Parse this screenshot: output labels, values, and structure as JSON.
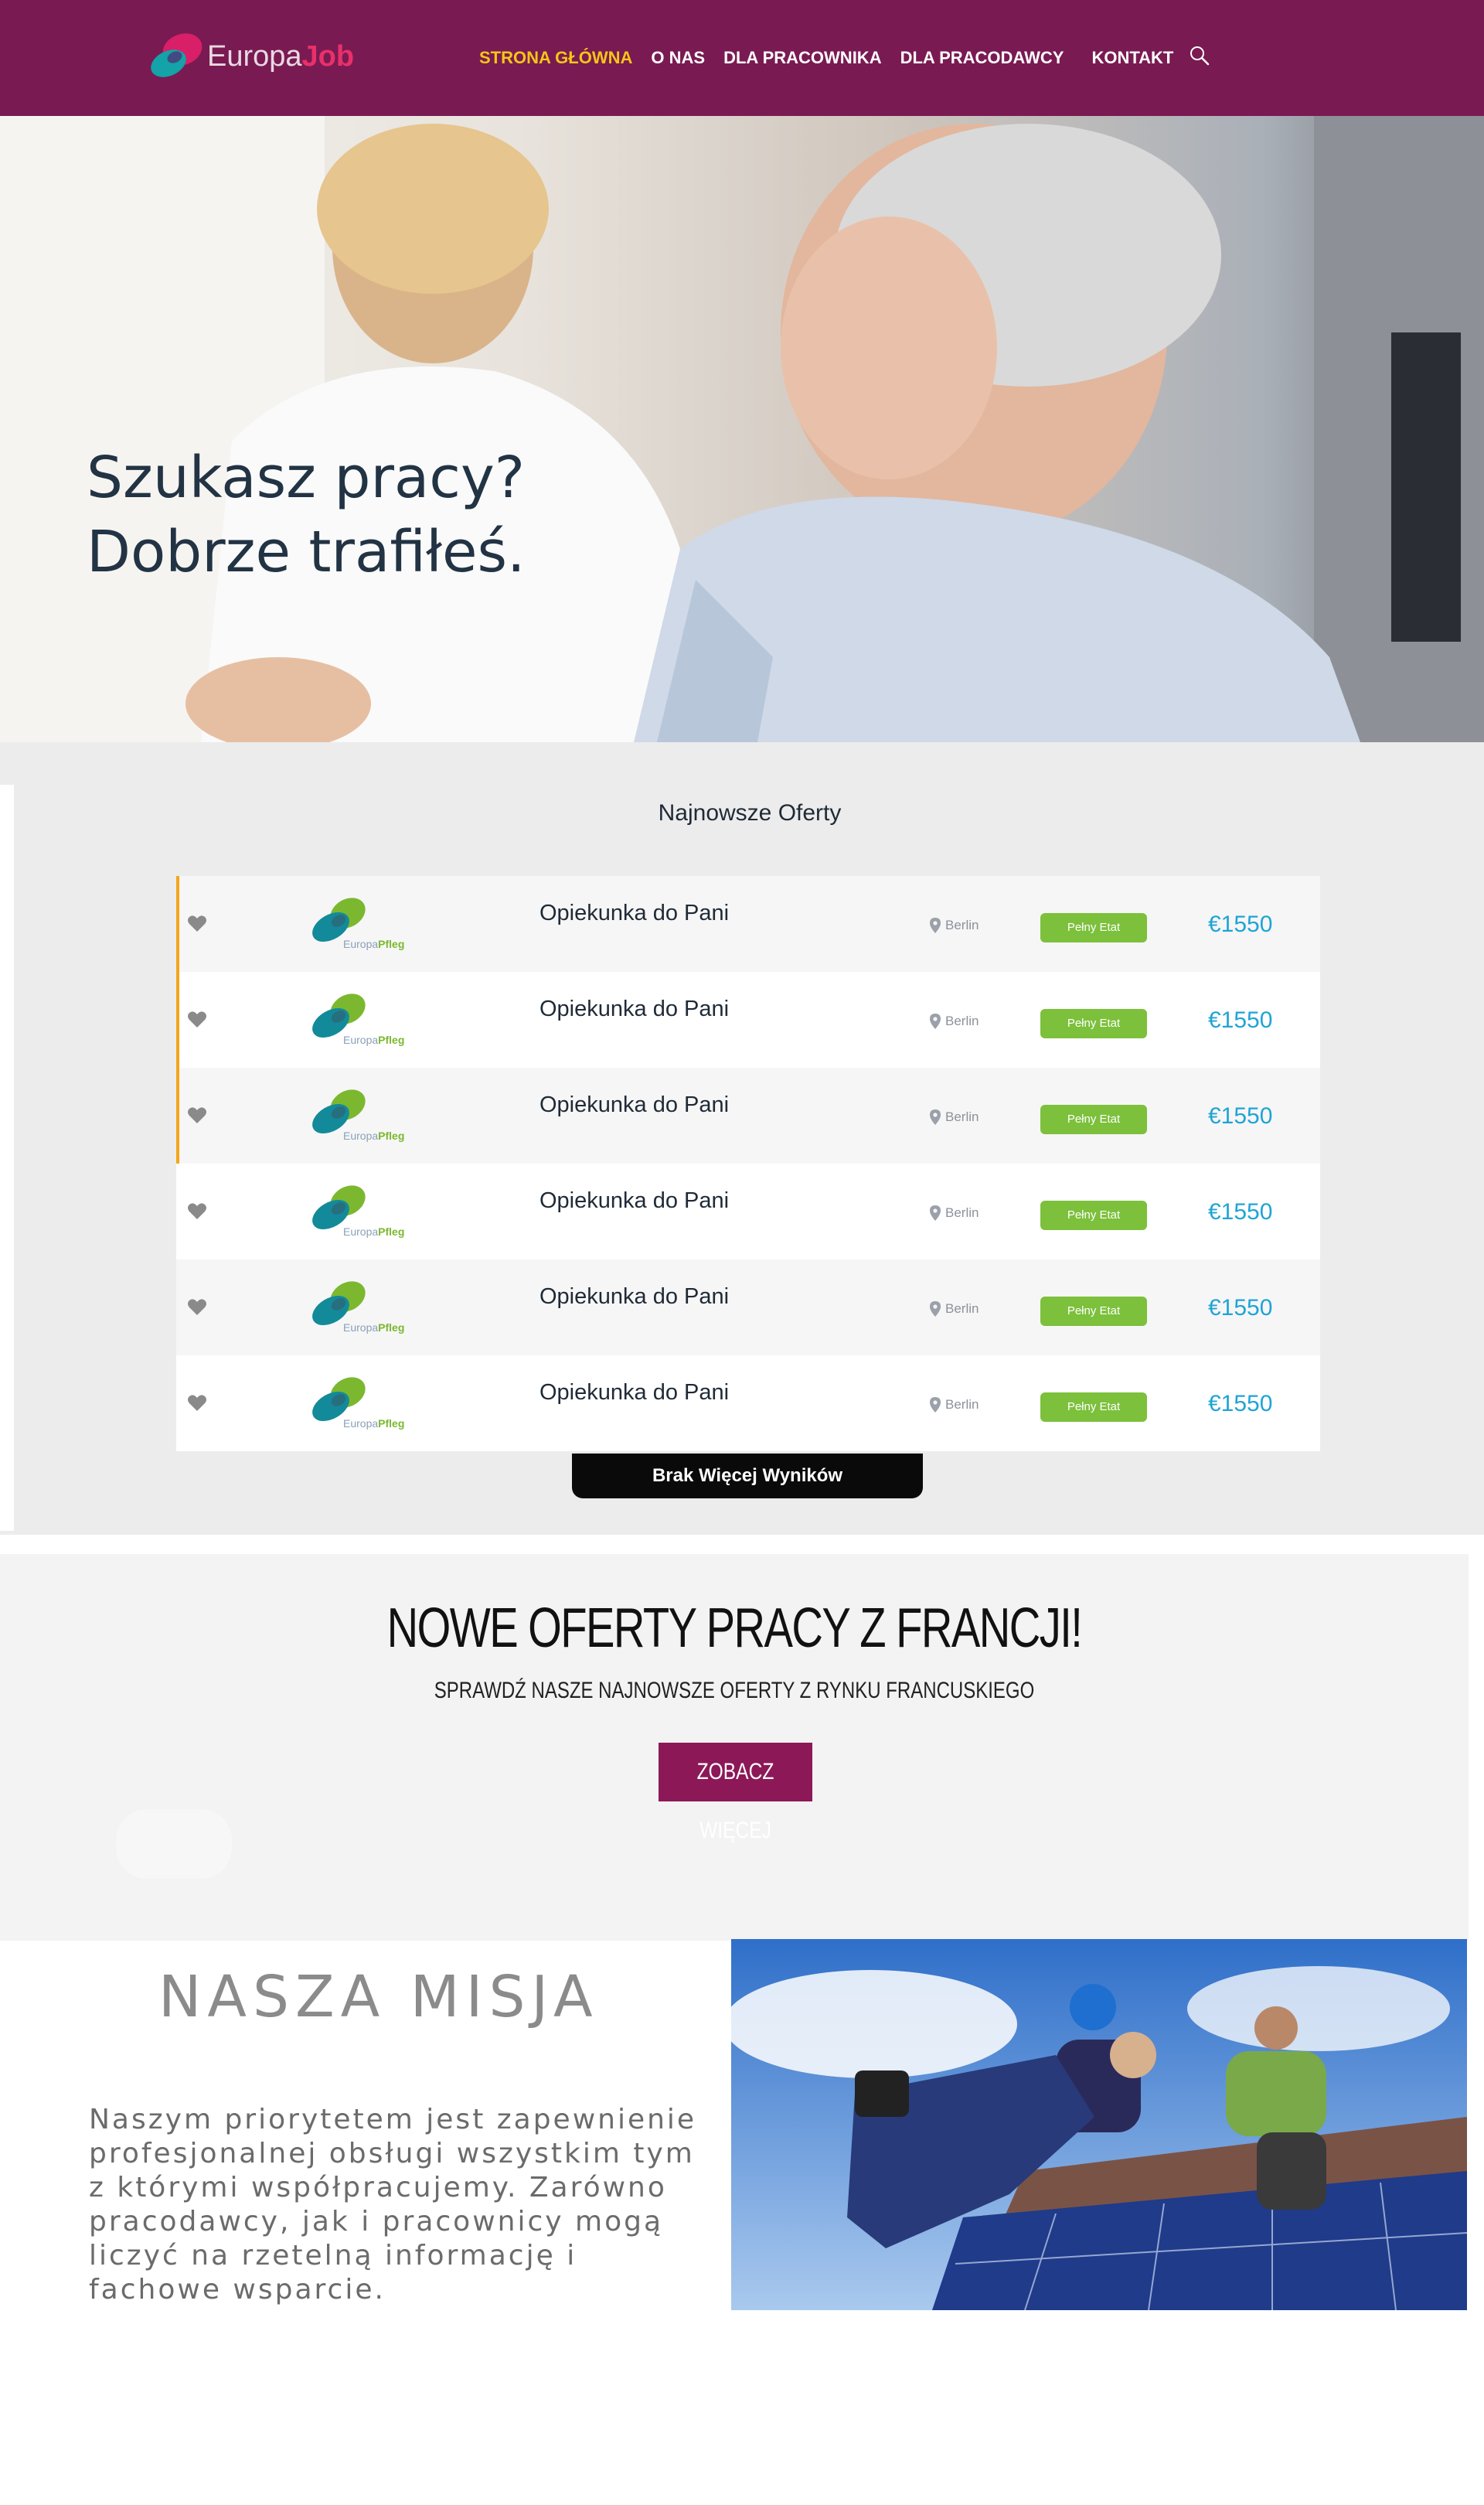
{
  "header": {
    "logo": {
      "word1": "Europa",
      "word2": "Job"
    },
    "nav": [
      {
        "label": "STRONA GŁÓWNA",
        "active": true
      },
      {
        "label": "O NAS",
        "active": false
      },
      {
        "label": "DLA PRACOWNIKA",
        "active": false
      },
      {
        "label": "DLA PRACODAWCY",
        "active": false
      },
      {
        "label": "KONTAKT",
        "active": false
      }
    ],
    "search_icon": "search-icon"
  },
  "hero": {
    "title": "Szukasz pracy?\nDobrze trafiłeś."
  },
  "offers": {
    "title": "Najnowsze Oferty",
    "jobs": [
      {
        "company": {
          "word1": "Europa",
          "word2": "Pfleg"
        },
        "title": "Opiekunka do Pani",
        "location": "Berlin",
        "type": "Pełny Etat",
        "salary": "€1550",
        "featured": true
      },
      {
        "company": {
          "word1": "Europa",
          "word2": "Pfleg"
        },
        "title": "Opiekunka do Pani",
        "location": "Berlin",
        "type": "Pełny Etat",
        "salary": "€1550",
        "featured": true
      },
      {
        "company": {
          "word1": "Europa",
          "word2": "Pfleg"
        },
        "title": "Opiekunka do Pani",
        "location": "Berlin",
        "type": "Pełny Etat",
        "salary": "€1550",
        "featured": true
      },
      {
        "company": {
          "word1": "Europa",
          "word2": "Pfleg"
        },
        "title": "Opiekunka do Pani",
        "location": "Berlin",
        "type": "Pełny Etat",
        "salary": "€1550",
        "featured": false
      },
      {
        "company": {
          "word1": "Europa",
          "word2": "Pfleg"
        },
        "title": "Opiekunka do Pani",
        "location": "Berlin",
        "type": "Pełny Etat",
        "salary": "€1550",
        "featured": false
      },
      {
        "company": {
          "word1": "Europa",
          "word2": "Pfleg"
        },
        "title": "Opiekunka do Pani",
        "location": "Berlin",
        "type": "Pełny Etat",
        "salary": "€1550",
        "featured": false
      }
    ],
    "more_button": "Brak Więcej Wyników"
  },
  "promo": {
    "title": "NOWE OFERTY PRACY Z FRANCJI!",
    "subtitle": "SPRAWDŹ NASZE NAJNOWSZE OFERTY Z RYNKU FRANCUSKIEGO",
    "button": "ZOBACZ WIĘCEJ"
  },
  "mission": {
    "title": "NASZA MISJA",
    "text": "Naszym priorytetem jest zapewnienie profesjonalnej obsługi wszystkim tym z którymi współpracujemy. Zarówno pracodawcy, jak i pracownicy mogą liczyć na rzetelną informację i fachowe wsparcie."
  },
  "colors": {
    "header_bg": "#7a1a52",
    "nav_active": "#f5c518",
    "badge_green": "#7cc03c",
    "salary_blue": "#1fa4d6",
    "promo_button": "#8c1858",
    "row_accent": "#f5a51a"
  }
}
